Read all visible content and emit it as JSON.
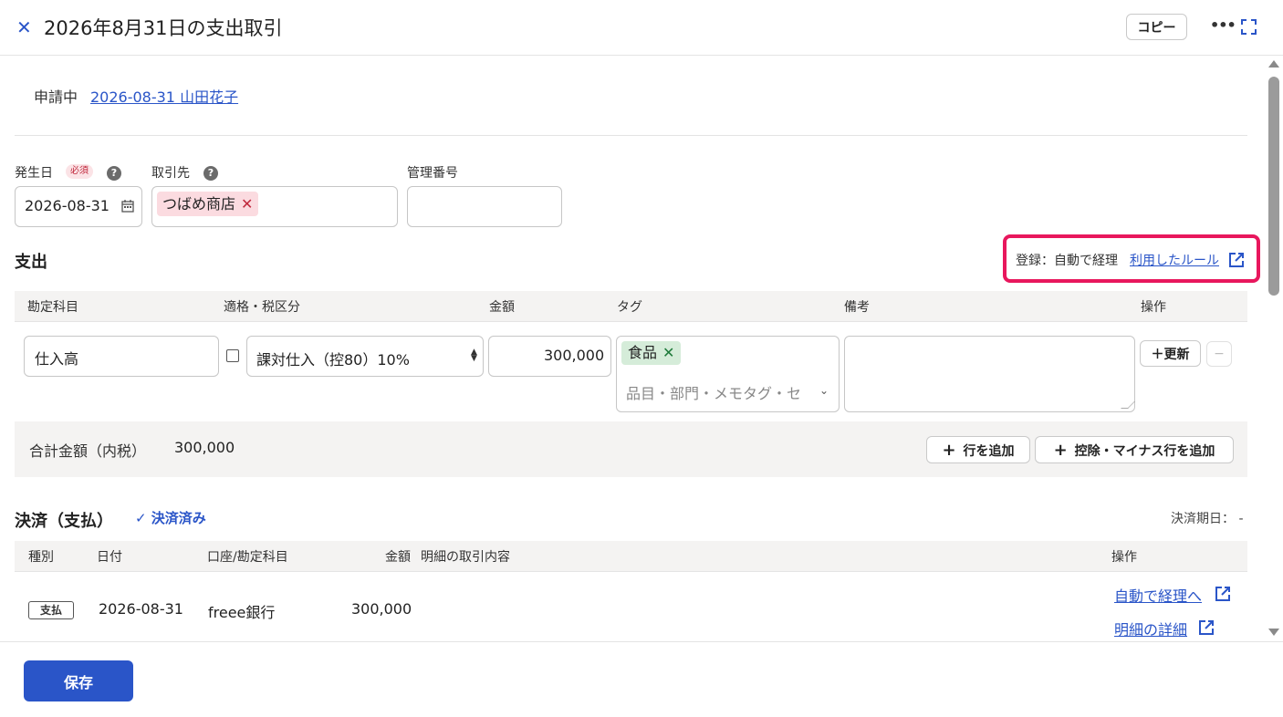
{
  "header": {
    "title": "2026年8月31日の支出取引",
    "copy_label": "コピー"
  },
  "status": {
    "label": "申請中",
    "link": "2026-08-31 山田花子"
  },
  "form": {
    "date_label": "発生日",
    "required_badge": "必須",
    "date_value": "2026-08-31",
    "partner_label": "取引先",
    "partner_tag": "つばめ商店",
    "mgmt_label": "管理番号",
    "mgmt_value": ""
  },
  "expense": {
    "title": "支出",
    "rule_text": "登録：自動で経理",
    "rule_link": "利用したルール",
    "headers": {
      "account": "勘定科目",
      "tax": "適格・税区分",
      "amount": "金額",
      "tag": "タグ",
      "note": "備考",
      "action": "操作"
    },
    "row": {
      "account": "仕入高",
      "tax_select": "課対仕入（控80）10%",
      "amount": "300,000",
      "tag_chip": "食品",
      "tag_placeholder": "品目・部門・メモタグ・セ",
      "note": "",
      "update_btn": "＋更新",
      "remove_btn": "−"
    },
    "total_label": "合計金額（内税）",
    "total_value": "300,000",
    "add_row_btn": "行を追加",
    "add_deduct_btn": "控除・マイナス行を追加"
  },
  "payment": {
    "title": "決済（支払）",
    "settled": "決済済み",
    "due": "決済期日： -",
    "headers": {
      "type": "種別",
      "date": "日付",
      "account": "口座/勘定科目",
      "amount": "金額",
      "detail": "明細の取引内容",
      "action": "操作"
    },
    "row": {
      "type": "支払",
      "date": "2026-08-31",
      "account": "freee銀行",
      "amount": "300,000",
      "link1": "自動で経理へ",
      "link2": "明細の詳細"
    }
  },
  "footer": {
    "save_label": "保存"
  },
  "colors": {
    "accent": "#2a55c8",
    "highlight": "#e8175d",
    "tag_pink": "#fbdbe0",
    "tag_green": "#d5ecd9"
  }
}
